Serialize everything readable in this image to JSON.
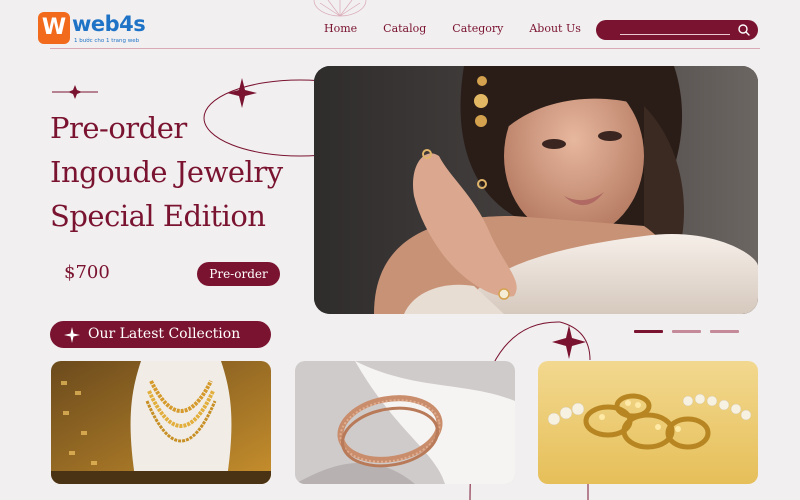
{
  "header": {
    "logo": {
      "badge": "W",
      "word": "web4s",
      "tagline": "1 bước cho 1 trang web"
    },
    "nav": [
      {
        "label": "Home"
      },
      {
        "label": "Catalog"
      },
      {
        "label": "Category"
      },
      {
        "label": "About Us"
      }
    ],
    "search": {
      "placeholder": "",
      "icon": "search-icon"
    }
  },
  "hero": {
    "title_lines": [
      "Pre-order",
      "Ingoude Jewelry",
      "Special Edition"
    ],
    "price": "$700",
    "cta_label": "Pre-order",
    "image": "model-with-jewelry",
    "carousel": {
      "slides": 3,
      "active": 0
    }
  },
  "collection": {
    "heading": "Our Latest Collection",
    "cards": [
      {
        "image": "gold-necklaces-on-display-bust"
      },
      {
        "image": "rose-gold-bracelet-on-white-fabric"
      },
      {
        "image": "gold-rings-and-pearls"
      }
    ]
  },
  "colors": {
    "primary": "#7a1330",
    "background": "#f1eff0",
    "logo_orange": "#f26a1b",
    "logo_blue": "#1f73c6",
    "inactive_dot": "#c48a9a"
  }
}
